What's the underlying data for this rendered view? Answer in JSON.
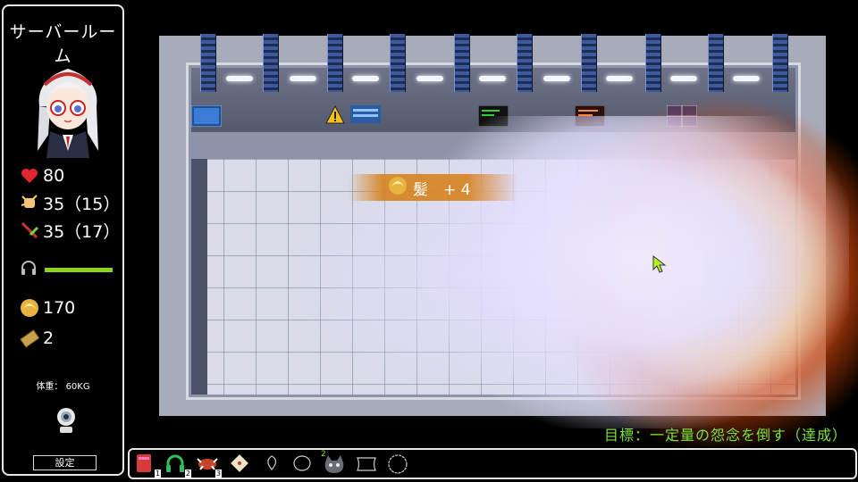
{
  "status_panel": {
    "location": "サーバールーム",
    "hp": "80",
    "attack": "35（15）",
    "defense": "35（17）",
    "bgm_volume": 1.0,
    "hair": "170",
    "tickets": "2",
    "weight": "体重： 60KG",
    "settings_label": "設定"
  },
  "map": {
    "popup_label": "髪　+ 4"
  },
  "goal_text": "目標：一定量の怨念を倒す（達成）",
  "hotbar": {
    "slots": [
      {
        "icon": "red-book-icon",
        "num": "1"
      },
      {
        "icon": "green-headphones-icon",
        "num": "2"
      },
      {
        "icon": "red-crab-item-icon",
        "num": "3"
      },
      {
        "icon": "letter-scroll-icon",
        "num": ""
      },
      {
        "icon": "empty-slot-outline-1",
        "num": ""
      },
      {
        "icon": "empty-slot-outline-2",
        "num": ""
      },
      {
        "icon": "gray-cat-icon",
        "num": "2"
      },
      {
        "icon": "empty-slot-outline-3",
        "num": ""
      },
      {
        "icon": "empty-slot-outline-4",
        "num": ""
      }
    ]
  },
  "colors": {
    "hp": "#e2262f",
    "goal": "#7be33b",
    "bgm_bar": "#8fd21a"
  }
}
